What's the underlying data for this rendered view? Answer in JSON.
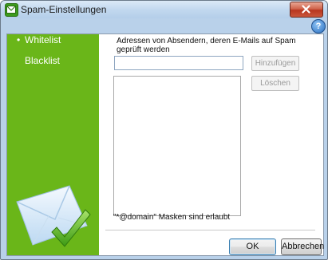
{
  "window": {
    "title": "Spam-Einstellungen",
    "help_symbol": "?"
  },
  "sidebar": {
    "items": [
      {
        "label": "Whitelist",
        "selected": true,
        "bullet": "•"
      },
      {
        "label": "Blacklist",
        "selected": false,
        "bullet": ""
      }
    ]
  },
  "main": {
    "description": "Adressen von Absendern, deren E-Mails auf Spam geprüft werden",
    "address_input": {
      "value": "",
      "placeholder": ""
    },
    "add_label": "Hinzufügen",
    "delete_label": "Löschen",
    "hint": "\"*@domain\" Masken sind erlaubt"
  },
  "footer": {
    "ok_label": "OK",
    "cancel_label": "Abbrechen"
  },
  "colors": {
    "sidebar": "#6ab619",
    "title_bar": "#c2d8ef",
    "accent_check": "#58b91f"
  }
}
